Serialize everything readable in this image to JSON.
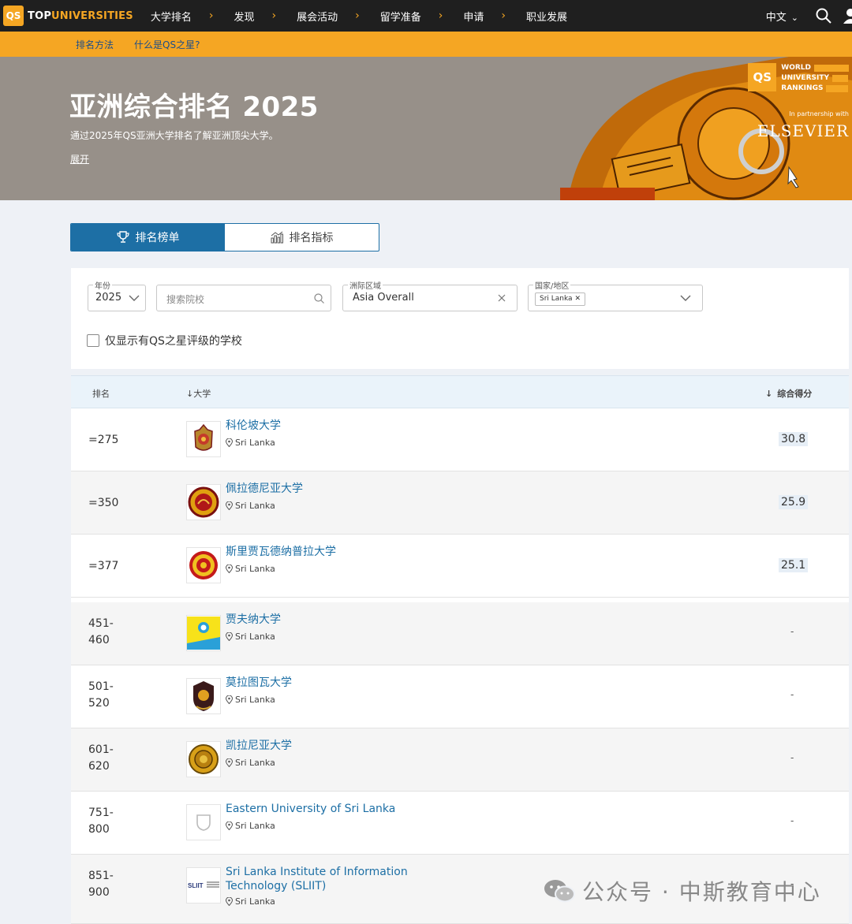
{
  "nav": {
    "logo_badge": "QS",
    "logo_top": "TOP",
    "logo_rest": "UNIVERSITIES",
    "items": [
      "大学排名",
      "发现",
      "展会活动",
      "留学准备",
      "申请",
      "职业发展"
    ],
    "lang": "中文"
  },
  "subnav": {
    "items": [
      "排名方法",
      "什么是QS之星?"
    ]
  },
  "hero": {
    "title": "亚洲综合排名 2025",
    "subtitle": "通过2025年QS亚洲大学排名了解亚洲顶尖大学。",
    "expand": "展开",
    "badge": "QS",
    "badge_lines": [
      "WORLD",
      "UNIVERSITY",
      "RANKINGS"
    ],
    "partner": "In partnership with",
    "partner_name": "ELSEVIER"
  },
  "tabs": {
    "rankings": "排名榜单",
    "indicators": "排名指标"
  },
  "filters": {
    "year_label": "年份",
    "year_value": "2025",
    "search_placeholder": "搜索院校",
    "region_label": "洲际区域",
    "region_value": "Asia Overall",
    "country_label": "国家/地区",
    "country_chip": "Sri Lanka",
    "stars_only": "仅显示有QS之星评级的学校"
  },
  "table": {
    "col_rank": "排名",
    "col_university": "大学",
    "col_score": "综合得分",
    "rows": [
      {
        "rank": "=275",
        "name": "科伦坡大学",
        "location": "Sri Lanka",
        "score": "30.8"
      },
      {
        "rank": "=350",
        "name": "佩拉德尼亚大学",
        "location": "Sri Lanka",
        "score": "25.9"
      },
      {
        "rank": "=377",
        "name": "斯里贾瓦德纳普拉大学",
        "location": "Sri Lanka",
        "score": "25.1"
      },
      {
        "rank": "451-\n460",
        "name": "贾夫纳大学",
        "location": "Sri Lanka",
        "score": "-"
      },
      {
        "rank": "501-\n520",
        "name": "莫拉图瓦大学",
        "location": "Sri Lanka",
        "score": "-"
      },
      {
        "rank": "601-\n620",
        "name": "凯拉尼亚大学",
        "location": "Sri Lanka",
        "score": "-"
      },
      {
        "rank": "751-\n800",
        "name": "Eastern University of Sri Lanka",
        "location": "Sri Lanka",
        "score": "-"
      },
      {
        "rank": "851-\n900",
        "name": "Sri Lanka Institute of Information Technology (SLIIT)",
        "location": "Sri Lanka",
        "score": "-"
      }
    ]
  },
  "watermark": "公众号 · 中斯教育中心",
  "colors": {
    "brand_orange": "#f5a623",
    "brand_blue": "#1d6fa5",
    "nav_bg": "#1f1f1f"
  }
}
